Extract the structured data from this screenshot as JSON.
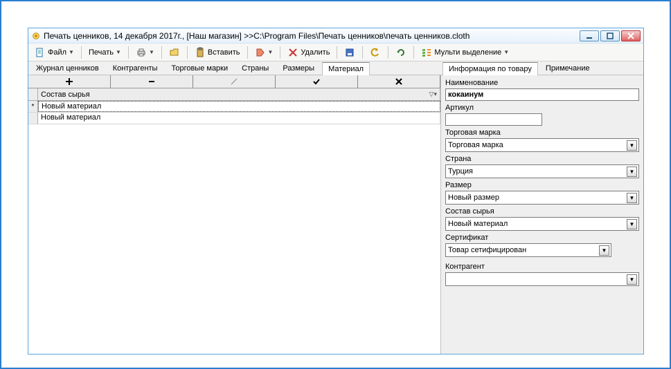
{
  "window": {
    "title": "Печать ценников, 14 декабря 2017г., [Наш магазин] >>C:\\Program Files\\Печать ценников\\печать ценников.cloth"
  },
  "toolbar": {
    "file": "Файл",
    "print": "Печать",
    "paste": "Вставить",
    "delete": "Удалить",
    "multi": "Мульти выделение"
  },
  "tabs": {
    "journal": "Журнал ценников",
    "contractors": "Контрагенты",
    "brands": "Торговые марки",
    "countries": "Страны",
    "sizes": "Размеры",
    "material": "Материал"
  },
  "grid": {
    "header": "Состав сырья",
    "rows": [
      {
        "indicator": "*",
        "value": "Новый материал"
      },
      {
        "indicator": "",
        "value": "Новый материал"
      }
    ]
  },
  "actions": {
    "plus": "+",
    "minus": "—",
    "edit": "/",
    "check": "✓",
    "cross": "✕"
  },
  "right_tabs": {
    "info": "Информация по товару",
    "note": "Примечание"
  },
  "form": {
    "name_label": "Наименование",
    "name_value": "кокаинум",
    "article_label": "Артикул",
    "article_value": "",
    "brand_label": "Торговая марка",
    "brand_value": "Торговая марка",
    "country_label": "Страна",
    "country_value": "Турция",
    "size_label": "Размер",
    "size_value": "Новый размер",
    "material_label": "Состав сырья",
    "material_value": "Новый материал",
    "cert_label": "Сертификат",
    "cert_value": "Товар сетифицирован",
    "contractor_label": "Контрагент",
    "contractor_value": ""
  }
}
